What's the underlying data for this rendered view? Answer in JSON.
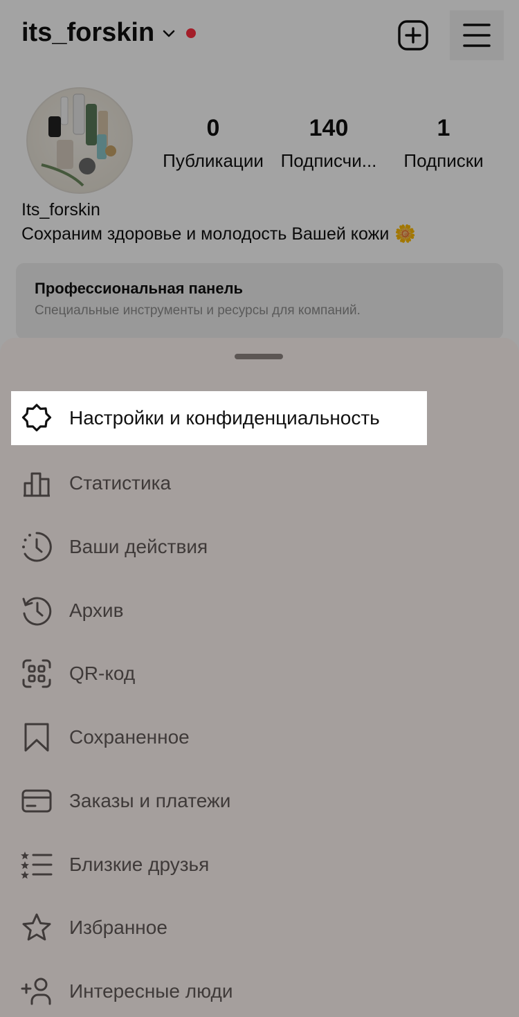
{
  "header": {
    "username": "its_forskin",
    "icons": {
      "chevron": "chevron-down-icon",
      "new_post": "add-square-icon",
      "menu": "hamburger-menu-icon"
    }
  },
  "profile": {
    "display_name": "Its_forskin",
    "bio": "Сохраним здоровье и молодость Вашей кожи",
    "bio_emoji": "🌼",
    "stats": [
      {
        "value": "0",
        "label": "Публикации"
      },
      {
        "value": "140",
        "label": "Подписчи..."
      },
      {
        "value": "1",
        "label": "Подписки"
      }
    ]
  },
  "pro_panel": {
    "title": "Профессиональная панель",
    "subtitle": "Специальные инструменты и ресурсы для компаний."
  },
  "sheet": {
    "items": [
      {
        "label": "Настройки и конфиденциальность",
        "icon": "settings-gear-icon",
        "highlighted": true
      },
      {
        "label": "Статистика",
        "icon": "bar-chart-icon"
      },
      {
        "label": "Ваши действия",
        "icon": "activity-clock-icon"
      },
      {
        "label": "Архив",
        "icon": "archive-history-icon"
      },
      {
        "label": "QR-код",
        "icon": "qr-code-icon"
      },
      {
        "label": "Сохраненное",
        "icon": "bookmark-icon"
      },
      {
        "label": "Заказы и платежи",
        "icon": "credit-card-icon"
      },
      {
        "label": "Близкие друзья",
        "icon": "close-friends-list-icon"
      },
      {
        "label": "Избранное",
        "icon": "star-icon"
      },
      {
        "label": "Интересные люди",
        "icon": "add-person-icon"
      }
    ]
  },
  "colors": {
    "sheet_bg": "#a59f9d",
    "overlay": "rgba(0,0,0,0.36)",
    "notification_dot": "#ff3040",
    "highlight_bg": "#ffffff"
  }
}
